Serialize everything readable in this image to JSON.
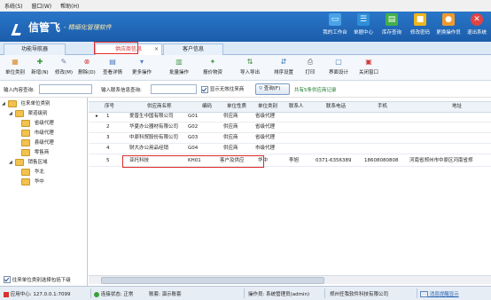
{
  "menu": [
    "系统(S)",
    "窗口(W)",
    "帮助(H)"
  ],
  "banner": {
    "name": "信管飞",
    "slogan": "- 精细化管理软件",
    "nav": [
      {
        "label": "我的工作台",
        "icon": "monitor-icon",
        "color": "#4aa3e8"
      },
      {
        "label": "单据中心",
        "icon": "document-list-icon",
        "color": "#2f8fd9"
      },
      {
        "label": "库存查询",
        "icon": "inventory-icon",
        "color": "#43b04a"
      },
      {
        "label": "修改密码",
        "icon": "lock-icon",
        "color": "#f1b51c"
      },
      {
        "label": "更换操作员",
        "icon": "user-icon",
        "color": "#f29a2e"
      },
      {
        "label": "退出系统",
        "icon": "close-icon",
        "color": "#e24343"
      }
    ]
  },
  "tabs": [
    {
      "label": "功能导航器",
      "active": false
    },
    {
      "label": "供应商信息",
      "active": true
    },
    {
      "label": "客户信息",
      "active": false
    }
  ],
  "toolbar": [
    {
      "label": "单位类别",
      "icon": "category-icon",
      "color": "#d98a2b"
    },
    {
      "label": "新增(N)",
      "icon": "add-icon",
      "color": "#3a9a3a"
    },
    {
      "label": "修改(M)",
      "icon": "edit-icon",
      "color": "#6a7fa6"
    },
    {
      "label": "删除(D)",
      "icon": "delete-icon",
      "color": "#d23b3b"
    },
    {
      "label": "查看详情",
      "icon": "details-icon",
      "color": "#4a7cc2"
    },
    {
      "label": "更多操作",
      "icon": "more-icon",
      "color": "#4a7cc2"
    },
    {
      "label": "批量操作",
      "icon": "batch-icon",
      "color": "#4a9a4a"
    },
    {
      "label": "报价物资",
      "icon": "price-icon",
      "color": "#4a9a4a"
    },
    {
      "label": "导入导出",
      "icon": "import-export-icon",
      "color": "#3a8a3a"
    },
    {
      "label": "排序设置",
      "icon": "sort-icon",
      "color": "#3a7ab8"
    },
    {
      "label": "打印",
      "icon": "print-icon",
      "color": "#666666"
    },
    {
      "label": "界面设计",
      "icon": "design-icon",
      "color": "#3a7ab8"
    },
    {
      "label": "关闭窗口",
      "icon": "close-window-icon",
      "color": "#d23b3b"
    }
  ],
  "filter": {
    "content_label": "输入内容查询:",
    "contact_label": "输入联系信息查询:",
    "show_invalid_label": "显示无效往来商",
    "show_invalid_checked": true,
    "query_button": "查询(F)",
    "record_count": "共有5条供应商记录"
  },
  "tree": {
    "root": "往来单位类别",
    "groups": [
      {
        "label": "渠道级别",
        "children": [
          "省级代理",
          "市级代理",
          "县级代理",
          "零售商"
        ]
      },
      {
        "label": "销售区域",
        "children": [
          "华北",
          "华中"
        ]
      }
    ],
    "bottom_checkbox": "往来单位类别选择包括下级"
  },
  "grid": {
    "columns": [
      "序号",
      "供应商名称",
      "编码",
      "单位性质",
      "单位类别",
      "联系人",
      "联系电话",
      "手机",
      "地址"
    ],
    "rows": [
      [
        "1",
        "爱普生中国有限公司",
        "G01",
        "供应商",
        "省级代理",
        "",
        "",
        "",
        ""
      ],
      [
        "2",
        "华夏办公器材有限公司",
        "G02",
        "供应商",
        "省级代理",
        "",
        "",
        "",
        ""
      ],
      [
        "3",
        "中原科贸股份有限公司",
        "G03",
        "供应商",
        "省级代理",
        "",
        "",
        "",
        ""
      ],
      [
        "4",
        "财大办公用品经销",
        "G04",
        "供应商",
        "市级代理",
        "",
        "",
        "",
        ""
      ],
      [
        "5",
        "亚托科技",
        "KH01",
        "客户及供应",
        "华中",
        "李旭",
        "0371-6356389",
        "18608080808",
        "河南省郑州市中原区河南省郑"
      ]
    ]
  },
  "status": {
    "app_center": "应用中心: 127.0.0.1:7099",
    "conn": "连接状态: 正常",
    "account": "账套: 演示账套",
    "operator": "操作员: 系统管理员(admin)",
    "company": "郑州任我软件科技有限公司",
    "message": "消息提醒显示"
  }
}
